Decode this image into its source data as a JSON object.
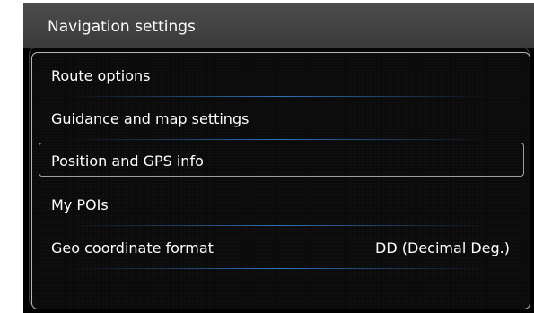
{
  "header": {
    "title": "Navigation settings"
  },
  "menu": {
    "items": [
      {
        "label": "Route options",
        "value": ""
      },
      {
        "label": "Guidance and map settings",
        "value": ""
      },
      {
        "label": "Position and GPS info",
        "value": "",
        "selected": true
      },
      {
        "label": "My POIs",
        "value": ""
      },
      {
        "label": "Geo coordinate format",
        "value": "DD (Decimal Deg.)"
      }
    ]
  },
  "colors": {
    "header_bg": "#444444",
    "separator_accent": "#2f72b8",
    "text": "#ffffff"
  }
}
